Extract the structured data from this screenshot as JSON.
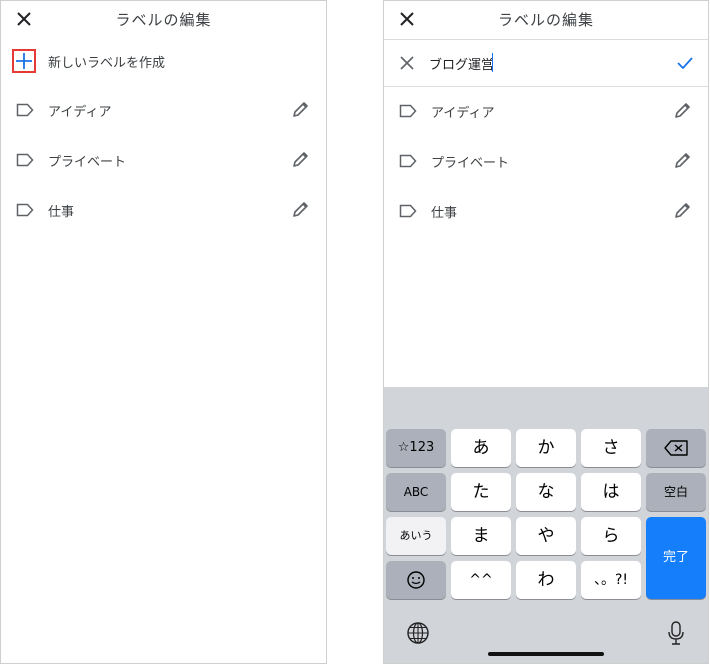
{
  "left": {
    "title": "ラベルの編集",
    "create_label": "新しいラベルを作成",
    "labels": [
      {
        "name": "アイディア"
      },
      {
        "name": "プライベート"
      },
      {
        "name": "仕事"
      }
    ],
    "highlight_color": "#e53935",
    "accent_color": "#1a73e8"
  },
  "right": {
    "title": "ラベルの編集",
    "input_value": "ブログ運営",
    "labels": [
      {
        "name": "アイディア"
      },
      {
        "name": "プライベート"
      },
      {
        "name": "仕事"
      }
    ],
    "keyboard": {
      "rows": [
        [
          "☆123",
          "あ",
          "か",
          "さ",
          "⌫"
        ],
        [
          "ABC",
          "た",
          "な",
          "は",
          "空白"
        ],
        [
          "あいう",
          "ま",
          "や",
          "ら",
          "完了"
        ],
        [
          "😐",
          "^^",
          "わ",
          "、。?!"
        ]
      ],
      "done_label": "完了",
      "space_label": "空白",
      "done_color": "#147efb"
    }
  }
}
